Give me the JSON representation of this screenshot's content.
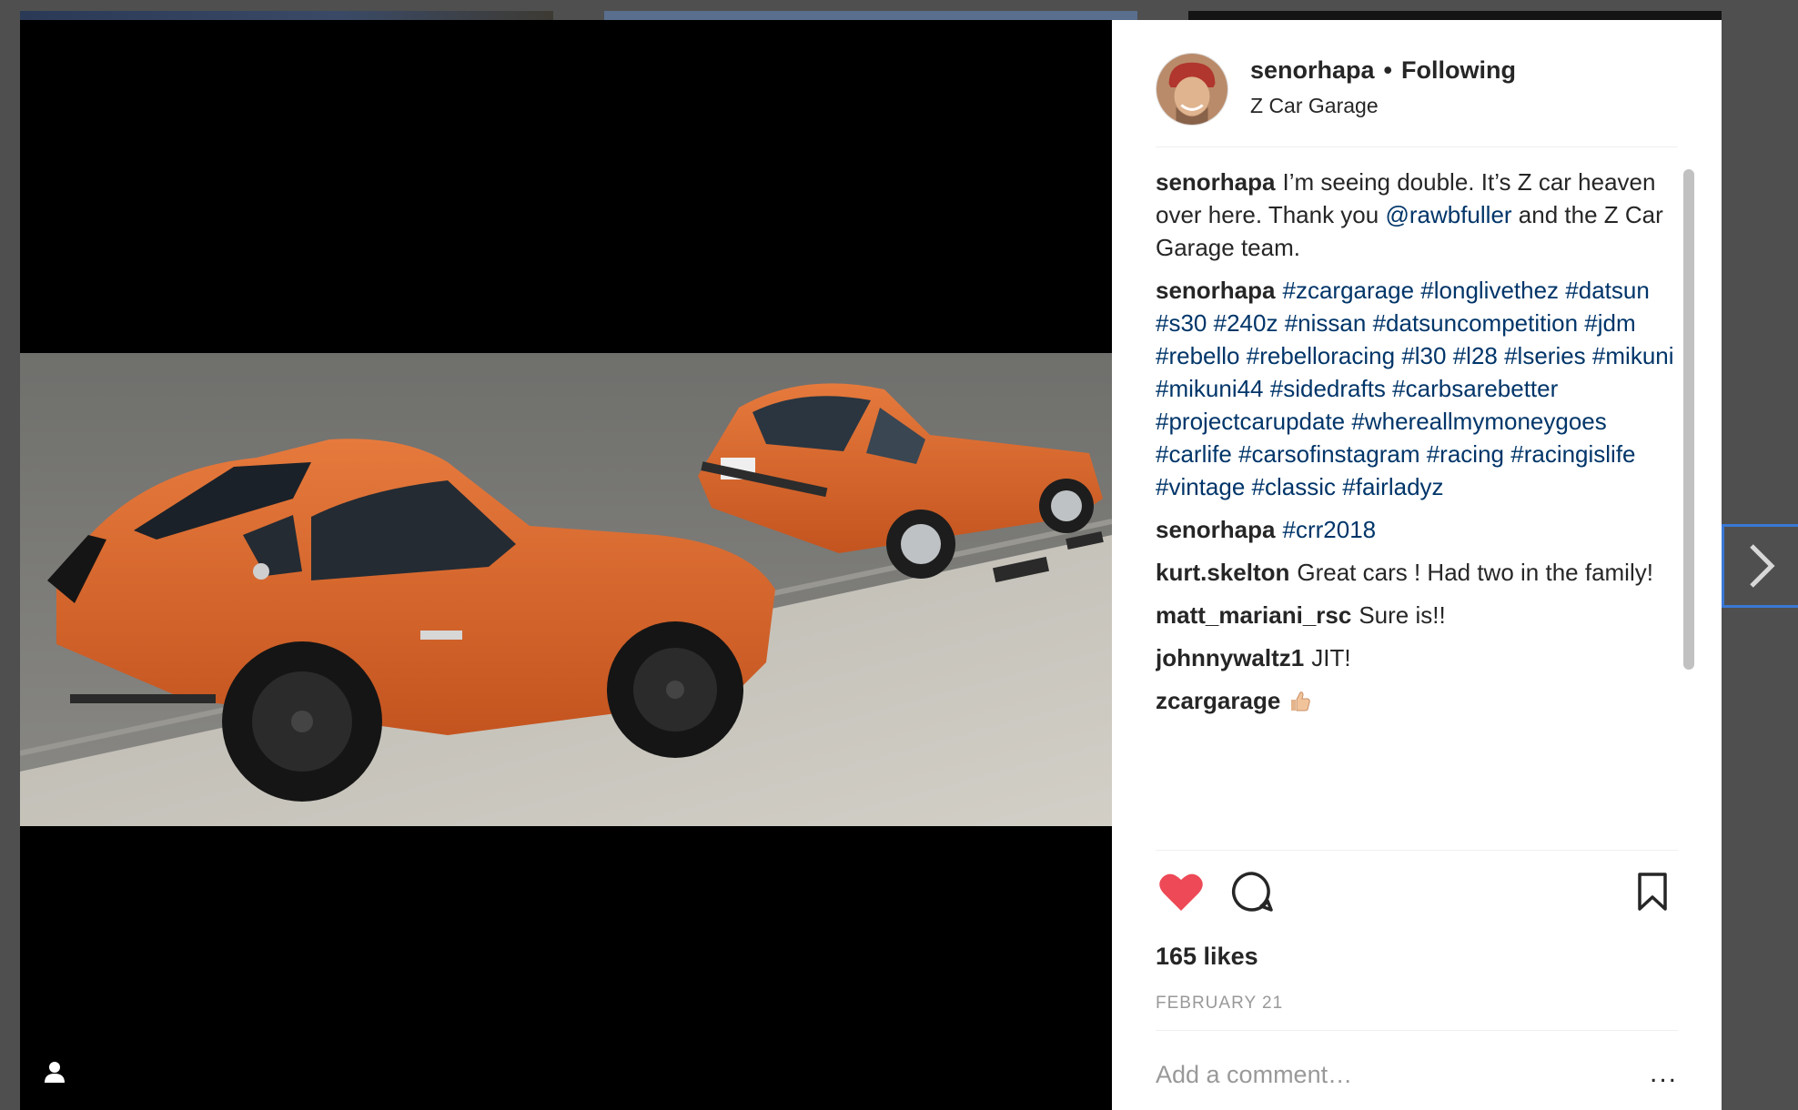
{
  "post": {
    "username": "senorhapa",
    "separator": "•",
    "follow_status": "Following",
    "location": "Z Car Garage",
    "likes": "165 likes",
    "date": "FEBRUARY 21",
    "add_comment_placeholder": "Add a comment…",
    "more_label": "..."
  },
  "comments": [
    {
      "user": "senorhapa",
      "parts": [
        {
          "t": "I’m seeing double. It’s Z car heaven over here. Thank you "
        },
        {
          "t": "@rawbfuller",
          "link": true
        },
        {
          "t": " and the Z Car Garage team."
        }
      ]
    },
    {
      "user": "senorhapa",
      "parts": [
        {
          "t": "#zcargarage",
          "link": true
        },
        {
          "t": " "
        },
        {
          "t": "#longlivethez",
          "link": true
        },
        {
          "t": " "
        },
        {
          "t": "#datsun",
          "link": true
        },
        {
          "t": " "
        },
        {
          "t": "#s30",
          "link": true
        },
        {
          "t": " "
        },
        {
          "t": "#240z",
          "link": true
        },
        {
          "t": " "
        },
        {
          "t": "#nissan",
          "link": true
        },
        {
          "t": " "
        },
        {
          "t": "#datsuncompetition",
          "link": true
        },
        {
          "t": " "
        },
        {
          "t": "#jdm",
          "link": true
        },
        {
          "t": " "
        },
        {
          "t": "#rebello",
          "link": true
        },
        {
          "t": " "
        },
        {
          "t": "#rebelloracing",
          "link": true
        },
        {
          "t": " "
        },
        {
          "t": "#l30",
          "link": true
        },
        {
          "t": " "
        },
        {
          "t": "#l28",
          "link": true
        },
        {
          "t": " "
        },
        {
          "t": "#lseries",
          "link": true
        },
        {
          "t": " "
        },
        {
          "t": "#mikuni",
          "link": true
        },
        {
          "t": " "
        },
        {
          "t": "#mikuni44",
          "link": true
        },
        {
          "t": " "
        },
        {
          "t": "#sidedrafts",
          "link": true
        },
        {
          "t": " "
        },
        {
          "t": "#carbsarebetter",
          "link": true
        },
        {
          "t": " "
        },
        {
          "t": "#projectcarupdate",
          "link": true
        },
        {
          "t": " "
        },
        {
          "t": "#whereallmymoneygoes",
          "link": true
        },
        {
          "t": " "
        },
        {
          "t": "#carlife",
          "link": true
        },
        {
          "t": " "
        },
        {
          "t": "#carsofinstagram",
          "link": true
        },
        {
          "t": " "
        },
        {
          "t": "#racing",
          "link": true
        },
        {
          "t": " "
        },
        {
          "t": "#racingislife",
          "link": true
        },
        {
          "t": " "
        },
        {
          "t": "#vintage",
          "link": true
        },
        {
          "t": " "
        },
        {
          "t": "#classic",
          "link": true
        },
        {
          "t": " "
        },
        {
          "t": "#fairladyz",
          "link": true
        }
      ]
    },
    {
      "user": "senorhapa",
      "parts": [
        {
          "t": "#crr2018",
          "link": true
        }
      ]
    },
    {
      "user": "kurt.skelton",
      "parts": [
        {
          "t": "Great cars ! Had two in the family!"
        }
      ]
    },
    {
      "user": "matt_mariani_rsc",
      "parts": [
        {
          "t": "Sure is!!"
        }
      ]
    },
    {
      "user": "johnnywaltz1",
      "parts": [
        {
          "t": "JIT!"
        }
      ]
    },
    {
      "user": "zcargarage",
      "parts": [],
      "emoji": "thumbs-up"
    }
  ],
  "icons": {
    "like": "heart-icon",
    "comment": "comment-bubble-icon",
    "save": "bookmark-icon",
    "next": "chevron-right-icon",
    "user_tag": "person-icon"
  },
  "colors": {
    "like_red": "#ed4956",
    "link_blue": "#003569",
    "text": "#262626",
    "muted": "#999999",
    "car_orange": "#d9652e",
    "backdrop": "#4f4f4f"
  }
}
